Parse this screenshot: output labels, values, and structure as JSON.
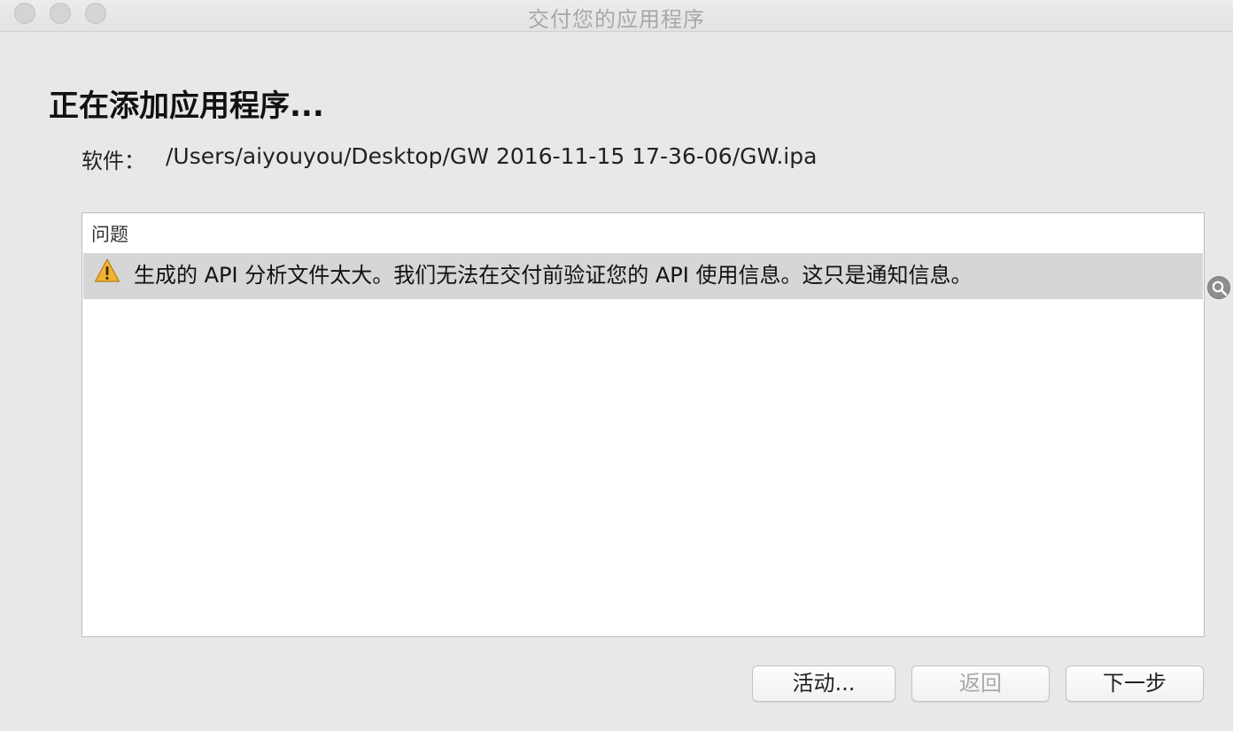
{
  "window": {
    "title": "交付您的应用程序"
  },
  "heading": "正在添加应用程序...",
  "software": {
    "label": "软件：",
    "path": "/Users/aiyouyou/Desktop/GW 2016-11-15 17-36-06/GW.ipa"
  },
  "issues": {
    "header": "问题",
    "items": [
      {
        "icon": "warning-icon",
        "text": "生成的 API 分析文件太大。我们无法在交付前验证您的 API 使用信息。这只是通知信息。"
      }
    ]
  },
  "buttons": {
    "activity": "活动...",
    "back": "返回",
    "next": "下一步"
  },
  "colors": {
    "warning": "#f2b233",
    "selected_row": "#d6d6d6",
    "disabled_text": "#a9a9a9"
  }
}
